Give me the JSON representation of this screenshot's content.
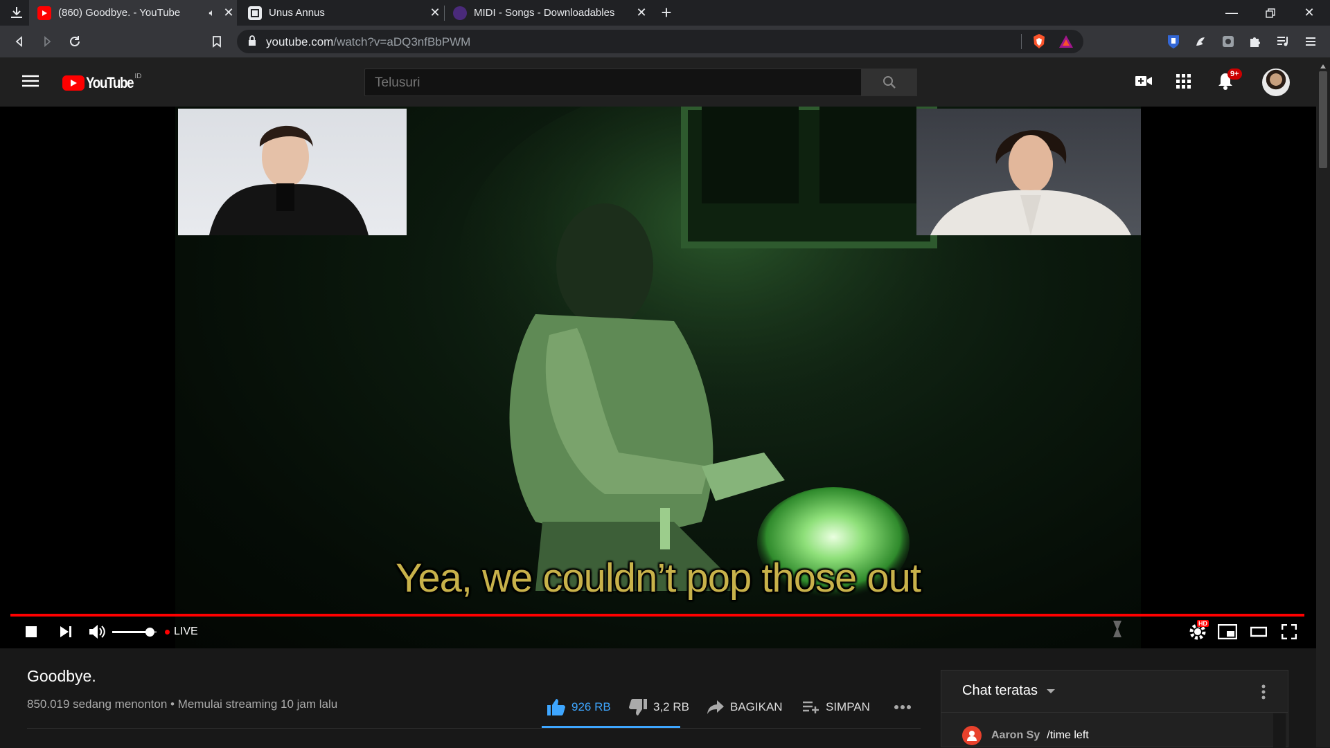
{
  "browser": {
    "tabs": [
      {
        "title": "(860) Goodbye. - YouTube",
        "active": true
      },
      {
        "title": "Unus Annus",
        "active": false
      },
      {
        "title": "MIDI - Songs - Downloadables",
        "active": false
      }
    ],
    "url_host": "youtube.com",
    "url_path": "/watch?v=aDQ3nfBbPWM"
  },
  "youtube": {
    "region_badge": "ID",
    "search_placeholder": "Telusuri",
    "notification_count": "9+"
  },
  "player": {
    "subtitle": "Yea, we couldn’t pop those out",
    "live_label": "LIVE",
    "hd_badge": "HD",
    "volume_level": 0.85
  },
  "video": {
    "title": "Goodbye.",
    "stats": "850.019 sedang menonton • Memulai streaming 10 jam lalu",
    "likes": "926 RB",
    "dislikes": "3,2 RB",
    "share_label": "BAGIKAN",
    "save_label": "SIMPAN"
  },
  "chat": {
    "title": "Chat teratas",
    "messages": [
      {
        "author": "Aaron Sy",
        "text": "/time left"
      }
    ]
  },
  "colors": {
    "youtube_red": "#ff0000",
    "like_blue": "#3ea6ff",
    "brave_orange": "#fb542b"
  }
}
